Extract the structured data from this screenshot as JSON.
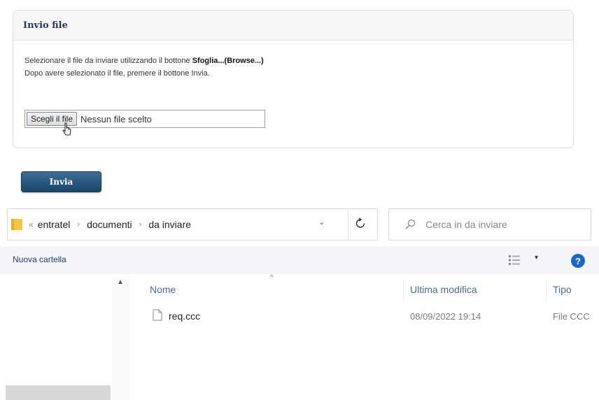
{
  "upload_panel": {
    "title": "Invio file",
    "instruction_line1_prefix": "Selezionare il file da inviare utilizzando il bottone ",
    "instruction_line1_bold": "Sfoglia...(Browse...)",
    "instruction_line2": "Dopo avere selezionato il file, premere il bottone Invia.",
    "file_button_label": "Scegli il file",
    "file_status": "Nessun file scelto"
  },
  "submit_label": "Invia",
  "explorer": {
    "breadcrumb_prefix": "«",
    "breadcrumb_separator": "›",
    "breadcrumb": [
      "entratel",
      "documenti",
      "da inviare"
    ],
    "dropdown_glyph": "⌄",
    "search_placeholder": "Cerca in da inviare",
    "toolbar": {
      "new_folder": "Nuova cartella",
      "view_caret": "▾",
      "help": "?"
    },
    "columns": {
      "name": "Nome",
      "modified": "Ultima modifica",
      "type": "Tipo"
    },
    "sort_glyph": "^",
    "nav_scroll_up": "▲",
    "files": [
      {
        "name": "req.ccc",
        "modified": "08/09/2022 19:14",
        "type": "File CCC"
      }
    ]
  },
  "icons": {
    "folder": "folder-icon",
    "refresh": "refresh-icon",
    "search": "search-icon",
    "view": "view-options-icon",
    "help": "help-icon",
    "file": "file-icon",
    "cursor": "mouse-cursor-icon"
  },
  "colors": {
    "submit_button": "#1a4568",
    "help_icon": "#1a67c7",
    "folder": "#f5c542",
    "column_header": "#4f6b8f"
  }
}
